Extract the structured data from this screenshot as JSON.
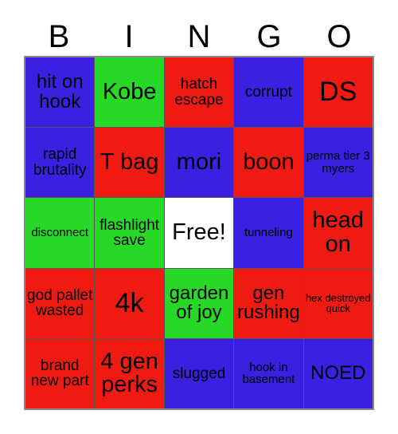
{
  "card": {
    "title": "BINGO",
    "header_letters": [
      "B",
      "I",
      "N",
      "G",
      "O"
    ],
    "colors": {
      "blue": "#3b20e2",
      "green": "#27d927",
      "red": "#ef1a11",
      "white": "#ffffff",
      "text": "#000000",
      "grid_line": "#555555",
      "background": "#ffffff"
    },
    "free_space_label": "Free!",
    "rows": [
      [
        {
          "label": "hit on hook",
          "color": "blue",
          "size": "lg"
        },
        {
          "label": "Kobe",
          "color": "green",
          "size": "xl"
        },
        {
          "label": "hatch escape",
          "color": "red",
          "size": "md"
        },
        {
          "label": "corrupt",
          "color": "blue",
          "size": "md"
        },
        {
          "label": "DS",
          "color": "red",
          "size": "xxl"
        }
      ],
      [
        {
          "label": "rapid brutality",
          "color": "blue",
          "size": "md"
        },
        {
          "label": "T bag",
          "color": "red",
          "size": "xl"
        },
        {
          "label": "mori",
          "color": "blue",
          "size": "xl"
        },
        {
          "label": "boon",
          "color": "red",
          "size": "xl"
        },
        {
          "label": "perma tier 3 myers",
          "color": "blue",
          "size": "sm"
        }
      ],
      [
        {
          "label": "disconnect",
          "color": "green",
          "size": "sm"
        },
        {
          "label": "flashlight save",
          "color": "green",
          "size": "md"
        },
        {
          "label": "Free!",
          "color": "white",
          "size": "xl"
        },
        {
          "label": "tunneling",
          "color": "blue",
          "size": "sm"
        },
        {
          "label": "head on",
          "color": "red",
          "size": "xl"
        }
      ],
      [
        {
          "label": "god pallet wasted",
          "color": "red",
          "size": "md"
        },
        {
          "label": "4k",
          "color": "red",
          "size": "xxl"
        },
        {
          "label": "garden of joy",
          "color": "green",
          "size": "lg"
        },
        {
          "label": "gen rushing",
          "color": "red",
          "size": "lg"
        },
        {
          "label": "hex destroyed quick",
          "color": "red",
          "size": "xs"
        }
      ],
      [
        {
          "label": "brand new part",
          "color": "red",
          "size": "md"
        },
        {
          "label": "4 gen perks",
          "color": "red",
          "size": "xl"
        },
        {
          "label": "slugged",
          "color": "blue",
          "size": "md"
        },
        {
          "label": "hook in basement",
          "color": "blue",
          "size": "sm"
        },
        {
          "label": "NOED",
          "color": "blue",
          "size": "lg"
        }
      ]
    ]
  }
}
